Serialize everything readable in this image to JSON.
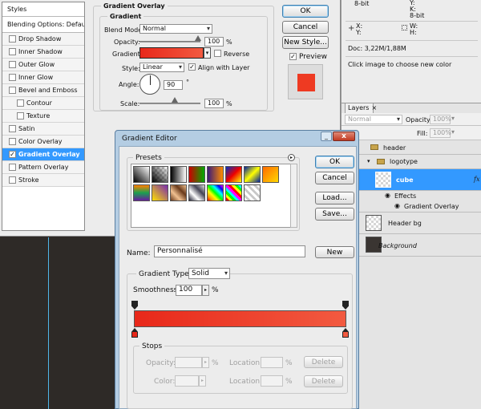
{
  "layer_style": {
    "styles_header": "Styles",
    "blending_options": "Blending Options: Default",
    "items": [
      {
        "label": "Drop Shadow",
        "checked": false
      },
      {
        "label": "Inner Shadow",
        "checked": false
      },
      {
        "label": "Outer Glow",
        "checked": false
      },
      {
        "label": "Inner Glow",
        "checked": false
      },
      {
        "label": "Bevel and Emboss",
        "checked": false
      },
      {
        "label": "Contour",
        "checked": false
      },
      {
        "label": "Texture",
        "checked": false
      },
      {
        "label": "Satin",
        "checked": false
      },
      {
        "label": "Color Overlay",
        "checked": false
      },
      {
        "label": "Gradient Overlay",
        "checked": true
      },
      {
        "label": "Pattern Overlay",
        "checked": false
      },
      {
        "label": "Stroke",
        "checked": false
      }
    ],
    "section_title": "Gradient Overlay",
    "group_title": "Gradient",
    "blend_mode_label": "Blend Mode:",
    "blend_mode_value": "Normal",
    "opacity_label": "Opacity:",
    "opacity_value": "100",
    "percent": "%",
    "gradient_label": "Gradient:",
    "reverse_label": "Reverse",
    "style_label": "Style:",
    "style_value": "Linear",
    "align_label": "Align with Layer",
    "angle_label": "Angle:",
    "angle_value": "90",
    "degree": "°",
    "scale_label": "Scale:",
    "scale_value": "100",
    "ok": "OK",
    "cancel": "Cancel",
    "new_style": "New Style...",
    "preview_label": "Preview",
    "preview_color": "#ee3a22"
  },
  "info_panel": {
    "rows": [
      "8-bit",
      "8-bit"
    ],
    "y_label": "Y:",
    "k_label": "K:",
    "x_label": "X:",
    "w_label": "W:",
    "h_label": "H:",
    "doc": "Doc: 3,22M/1,88M",
    "hint": "Click image to choose new color"
  },
  "layers_panel": {
    "tab": "Layers",
    "blend_mode": "Normal",
    "opacity_label": "Opacity:",
    "opacity_value": "100%",
    "fill_label": "Fill:",
    "fill_value": "100%",
    "rows": {
      "header": "header",
      "logotype": "logotype",
      "cube": "cube",
      "fx": "fx",
      "effects": "Effects",
      "gradient_overlay": "Gradient Overlay",
      "header_bg": "Header bg",
      "background": "Background"
    }
  },
  "gradient_editor": {
    "title": "Gradient Editor",
    "presets_label": "Presets",
    "ok": "OK",
    "cancel": "Cancel",
    "load": "Load...",
    "save": "Save...",
    "name_label": "Name:",
    "name_value": "Personnalisé",
    "new": "New",
    "gradient_type_label": "Gradient Type:",
    "gradient_type_value": "Solid",
    "smoothness_label": "Smoothness:",
    "smoothness_value": "100",
    "percent": "%",
    "stops_label": "Stops",
    "opacity_label": "Opacity:",
    "color_label": "Color:",
    "location_label": "Location:",
    "delete": "Delete",
    "gradient_start": "#e8281a",
    "gradient_end": "#f25a40"
  }
}
